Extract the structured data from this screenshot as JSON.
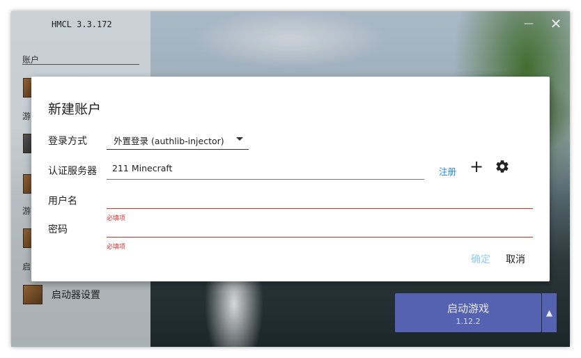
{
  "app": {
    "title": "HMCL 3.3.172"
  },
  "window_controls": {
    "minimize": "—",
    "close": "✕"
  },
  "sidebar": {
    "sections": [
      "账户",
      "游",
      "游",
      "启"
    ],
    "settings_label": "启动器设置"
  },
  "launch": {
    "label": "启动游戏",
    "version": "1.12.2",
    "arrow": "▲"
  },
  "dialog": {
    "title": "新建账户",
    "login_method_label": "登录方式",
    "login_method_value": "外置登录 (authlib-injector)",
    "auth_server_label": "认证服务器",
    "auth_server_value": "211 Minecraft",
    "register_link": "注册",
    "add_icon": "+",
    "username_label": "用户名",
    "username_value": "",
    "username_hint": "必填项",
    "password_label": "密码",
    "password_value": "",
    "password_hint": "必填项",
    "confirm_button": "确定",
    "cancel_button": "取消"
  },
  "colors": {
    "accent": "#5c6bc0",
    "error": "#d32f2f",
    "link": "#1e88e5",
    "confirm_disabled": "#90caf9"
  }
}
